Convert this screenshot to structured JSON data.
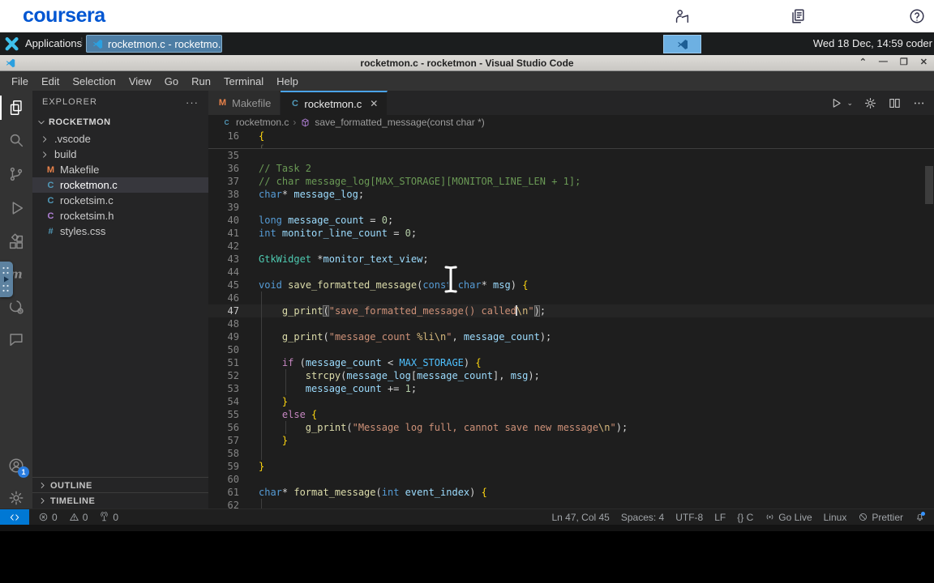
{
  "coursera_header": {
    "logo_text": "coursera",
    "brand_color": "#0056D2",
    "icons": [
      {
        "icon": "instructor",
        "name": "instructor-icon"
      },
      {
        "icon": "notes",
        "name": "notes-icon"
      },
      {
        "icon": "help",
        "name": "help-icon"
      }
    ]
  },
  "taskbar": {
    "applications_label": "Applications",
    "window_button_label": "rocketmon.c - rocketmo...",
    "clock": "Wed 18 Dec, 14:59 coder"
  },
  "window": {
    "title": "rocketmon.c - rocketmon - Visual Studio Code"
  },
  "menu_bar": [
    "File",
    "Edit",
    "Selection",
    "View",
    "Go",
    "Run",
    "Terminal",
    "Help"
  ],
  "activity_bar": {
    "top": [
      {
        "icon": "explorer",
        "name": "explorer",
        "active": true
      },
      {
        "icon": "search",
        "name": "search"
      },
      {
        "icon": "scm",
        "name": "source-control"
      },
      {
        "icon": "debug",
        "name": "run-and-debug"
      },
      {
        "icon": "extensions",
        "name": "extensions"
      },
      {
        "icon": "mext",
        "name": "makefile-tools"
      },
      {
        "icon": "remote",
        "name": "remote-explorer"
      },
      {
        "icon": "chat",
        "name": "comments"
      }
    ],
    "bottom": [
      {
        "icon": "account",
        "name": "accounts",
        "badge": "1"
      },
      {
        "icon": "gear",
        "name": "manage"
      }
    ]
  },
  "explorer": {
    "title": "EXPLORER",
    "more": "···",
    "root": "ROCKETMON",
    "items": [
      {
        "label": ".vscode",
        "kind": "folder"
      },
      {
        "label": "build",
        "kind": "folder"
      },
      {
        "label": "Makefile",
        "badge": "M",
        "color": "#e8824a"
      },
      {
        "label": "rocketmon.c",
        "badge": "C",
        "color": "#519aba",
        "selected": true
      },
      {
        "label": "rocketsim.c",
        "badge": "C",
        "color": "#519aba"
      },
      {
        "label": "rocketsim.h",
        "badge": "C",
        "color": "#b180d7"
      },
      {
        "label": "styles.css",
        "badge": "#",
        "color": "#519aba"
      }
    ],
    "sections": [
      "OUTLINE",
      "TIMELINE"
    ]
  },
  "tabs": [
    {
      "label": "Makefile",
      "badge": "M",
      "color": "#e8824a",
      "active": false
    },
    {
      "label": "rocketmon.c",
      "badge": "C",
      "color": "#519aba",
      "active": true,
      "closable": true
    }
  ],
  "editor_actions": [
    {
      "icon": "run",
      "name": "run-button",
      "chevron": true
    },
    {
      "icon": "gear",
      "name": "editor-settings-button"
    },
    {
      "icon": "split",
      "name": "split-editor-button"
    },
    {
      "icon": "more",
      "name": "editor-more-button"
    }
  ],
  "breadcrumb": {
    "file": "rocketmon.c",
    "symbol": "save_formatted_message(const char *)"
  },
  "code": {
    "lines": [
      {
        "n": 16,
        "divider": true,
        "t": [
          [
            "br",
            "{"
          ]
        ]
      },
      {
        "n": 35,
        "t": []
      },
      {
        "n": 36,
        "t": [
          [
            "cm",
            "// Task 2"
          ]
        ]
      },
      {
        "n": 37,
        "t": [
          [
            "cm",
            "// char message_log[MAX_STORAGE][MONITOR_LINE_LEN + 1];"
          ]
        ]
      },
      {
        "n": 38,
        "t": [
          [
            "kw",
            "char"
          ],
          [
            "pn",
            "* "
          ],
          [
            "vr",
            "message_log"
          ],
          [
            "pn",
            ";"
          ]
        ]
      },
      {
        "n": 39,
        "t": []
      },
      {
        "n": 40,
        "t": [
          [
            "kw",
            "long"
          ],
          [
            "pn",
            " "
          ],
          [
            "vr",
            "message_count"
          ],
          [
            "pn",
            " = "
          ],
          [
            "nm",
            "0"
          ],
          [
            "pn",
            ";"
          ]
        ]
      },
      {
        "n": 41,
        "t": [
          [
            "kw",
            "int"
          ],
          [
            "pn",
            " "
          ],
          [
            "vr",
            "monitor_line_count"
          ],
          [
            "pn",
            " = "
          ],
          [
            "nm",
            "0"
          ],
          [
            "pn",
            ";"
          ]
        ]
      },
      {
        "n": 42,
        "t": []
      },
      {
        "n": 43,
        "t": [
          [
            "ty",
            "GtkWidget"
          ],
          [
            "pn",
            " *"
          ],
          [
            "vr",
            "monitor_text_view"
          ],
          [
            "pn",
            ";"
          ]
        ]
      },
      {
        "n": 44,
        "t": []
      },
      {
        "n": 45,
        "t": [
          [
            "kw",
            "void"
          ],
          [
            "pn",
            " "
          ],
          [
            "fn",
            "save_formatted_message"
          ],
          [
            "pn",
            "("
          ],
          [
            "kw",
            "const"
          ],
          [
            "pn",
            " "
          ],
          [
            "kw",
            "char"
          ],
          [
            "pn",
            "* "
          ],
          [
            "vr",
            "msg"
          ],
          [
            "pn",
            ") "
          ],
          [
            "br",
            "{"
          ]
        ]
      },
      {
        "n": 46,
        "t": []
      },
      {
        "n": 47,
        "cur": true,
        "t": [
          [
            "pn",
            "    "
          ],
          [
            "fn",
            "g_print"
          ],
          [
            "ph",
            "("
          ],
          [
            "st",
            "\"save_formatted_message() called"
          ],
          [
            "cr",
            ""
          ],
          [
            "es",
            "\\n"
          ],
          [
            "st",
            "\""
          ],
          [
            "ph",
            ")"
          ],
          [
            "pn",
            ";"
          ]
        ]
      },
      {
        "n": 48,
        "t": []
      },
      {
        "n": 49,
        "t": [
          [
            "pn",
            "    "
          ],
          [
            "fn",
            "g_print"
          ],
          [
            "pn",
            "("
          ],
          [
            "st",
            "\"message_count "
          ],
          [
            "es",
            "%li\\n"
          ],
          [
            "st",
            "\""
          ],
          [
            "pn",
            ", "
          ],
          [
            "vr",
            "message_count"
          ],
          [
            "pn",
            ");"
          ]
        ]
      },
      {
        "n": 50,
        "t": []
      },
      {
        "n": 51,
        "t": [
          [
            "pn",
            "    "
          ],
          [
            "ct",
            "if"
          ],
          [
            "pn",
            " ("
          ],
          [
            "vr",
            "message_count"
          ],
          [
            "pn",
            " < "
          ],
          [
            "cs",
            "MAX_STORAGE"
          ],
          [
            "pn",
            ") "
          ],
          [
            "br",
            "{"
          ]
        ]
      },
      {
        "n": 52,
        "t": [
          [
            "pn",
            "        "
          ],
          [
            "fn",
            "strcpy"
          ],
          [
            "pn",
            "("
          ],
          [
            "vr",
            "message_log"
          ],
          [
            "pn",
            "["
          ],
          [
            "vr",
            "message_count"
          ],
          [
            "pn",
            "], "
          ],
          [
            "vr",
            "msg"
          ],
          [
            "pn",
            ");"
          ]
        ]
      },
      {
        "n": 53,
        "t": [
          [
            "pn",
            "        "
          ],
          [
            "vr",
            "message_count"
          ],
          [
            "pn",
            " += "
          ],
          [
            "nm",
            "1"
          ],
          [
            "pn",
            ";"
          ]
        ]
      },
      {
        "n": 54,
        "t": [
          [
            "pn",
            "    "
          ],
          [
            "br",
            "}"
          ]
        ]
      },
      {
        "n": 55,
        "t": [
          [
            "pn",
            "    "
          ],
          [
            "ct",
            "else"
          ],
          [
            "pn",
            " "
          ],
          [
            "br",
            "{"
          ]
        ]
      },
      {
        "n": 56,
        "t": [
          [
            "pn",
            "        "
          ],
          [
            "fn",
            "g_print"
          ],
          [
            "pn",
            "("
          ],
          [
            "st",
            "\"Message log full, cannot save new message"
          ],
          [
            "es",
            "\\n"
          ],
          [
            "st",
            "\""
          ],
          [
            "pn",
            ");"
          ]
        ]
      },
      {
        "n": 57,
        "t": [
          [
            "pn",
            "    "
          ],
          [
            "br",
            "}"
          ]
        ]
      },
      {
        "n": 58,
        "t": []
      },
      {
        "n": 59,
        "t": [
          [
            "br",
            "}"
          ]
        ]
      },
      {
        "n": 60,
        "t": []
      },
      {
        "n": 61,
        "t": [
          [
            "kw",
            "char"
          ],
          [
            "pn",
            "* "
          ],
          [
            "fn",
            "format_message"
          ],
          [
            "pn",
            "("
          ],
          [
            "kw",
            "int"
          ],
          [
            "pn",
            " "
          ],
          [
            "vr",
            "event_index"
          ],
          [
            "pn",
            ") "
          ],
          [
            "br",
            "{"
          ]
        ]
      },
      {
        "n": 62,
        "t": []
      }
    ]
  },
  "status_bar": {
    "left": [
      {
        "icon": "error",
        "label": "0",
        "name": "problems-errors"
      },
      {
        "icon": "warning",
        "label": "0",
        "name": "problems-warnings"
      },
      {
        "icon": "tower",
        "label": "0",
        "name": "ports-indicator"
      }
    ],
    "right": [
      {
        "label": "Ln 47, Col 45",
        "name": "cursor-position"
      },
      {
        "label": "Spaces: 4",
        "name": "indentation"
      },
      {
        "label": "UTF-8",
        "name": "encoding"
      },
      {
        "label": "LF",
        "name": "eol"
      },
      {
        "label": "{} C",
        "name": "language-mode"
      },
      {
        "icon": "broadcast",
        "label": "Go Live",
        "name": "go-live"
      },
      {
        "label": "Linux",
        "name": "remote-os"
      },
      {
        "icon": "prettier",
        "label": "Prettier",
        "name": "prettier"
      },
      {
        "icon": "bell",
        "label": "",
        "name": "notifications",
        "dot": true
      }
    ]
  }
}
